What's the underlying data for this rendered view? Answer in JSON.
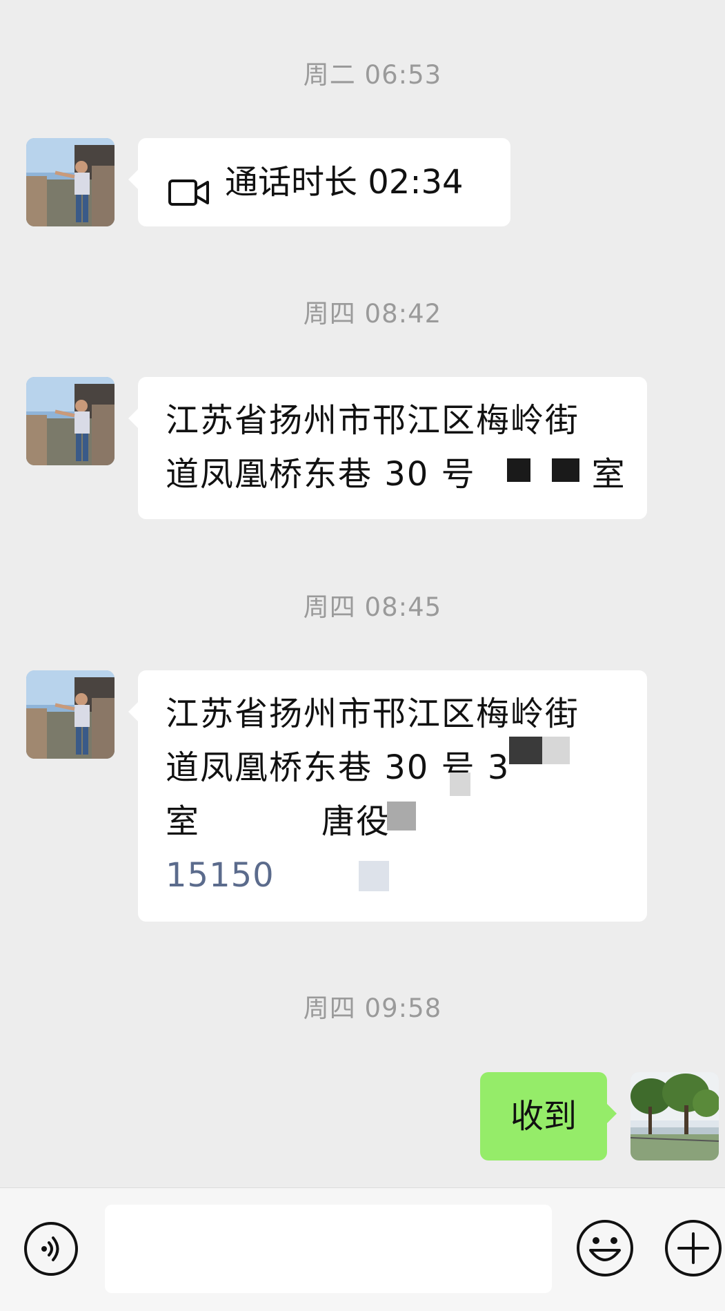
{
  "messages": [
    {
      "timestamp": "周二 06:53",
      "type": "call",
      "call_text": "通话时长 02:34",
      "icon": "video-call-icon"
    },
    {
      "timestamp": "周四 08:42",
      "type": "text",
      "lines": [
        "江苏省扬州市邗江区梅岭街",
        "道凤凰桥东巷 30 号",
        "室"
      ]
    },
    {
      "timestamp": "周四 08:45",
      "type": "text",
      "lines": [
        "江苏省扬州市邗江区梅岭街",
        "道凤凰桥东巷 30 号 3",
        "室",
        "唐役",
        "15150"
      ]
    },
    {
      "timestamp": "周四 09:58",
      "type": "text",
      "from": "self",
      "text": "收到"
    }
  ],
  "input_bar": {
    "voice_icon": "voice-icon",
    "emoji_icon": "emoji-icon",
    "plus_icon": "plus-icon",
    "input_value": ""
  }
}
